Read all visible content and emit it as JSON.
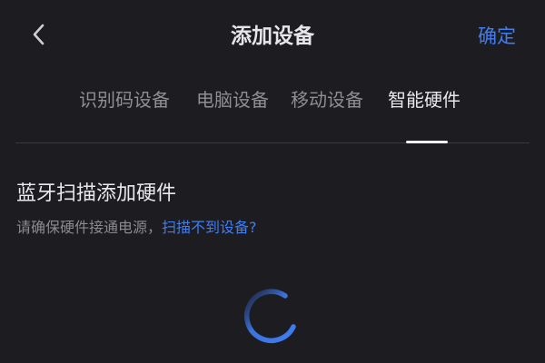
{
  "colors": {
    "background": "#1d1c21",
    "accent": "#3f7df2",
    "title": "#e6e6e8",
    "tab_inactive": "#8e8e93",
    "tab_active": "#e8e8ea",
    "hint": "#8a8a8f"
  },
  "header": {
    "back_icon": "chevron-left-icon",
    "title": "添加设备",
    "confirm_label": "确定"
  },
  "tabs": [
    {
      "label": "识别码设备",
      "active": false
    },
    {
      "label": "电脑设备",
      "active": false
    },
    {
      "label": "移动设备",
      "active": false
    },
    {
      "label": "智能硬件",
      "active": true
    }
  ],
  "content": {
    "section_title": "蓝牙扫描添加硬件",
    "hint_text": "请确保硬件接通电源，",
    "hint_link": "扫描不到设备?",
    "loading_icon": "spinner-icon"
  }
}
